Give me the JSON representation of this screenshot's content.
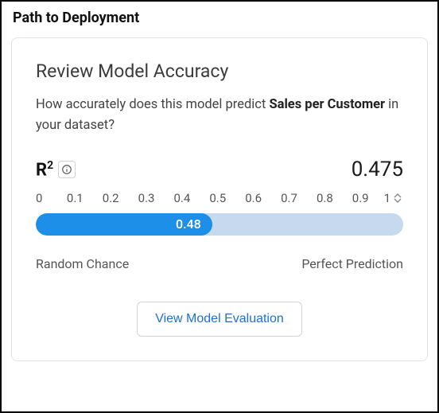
{
  "page": {
    "title": "Path to Deployment"
  },
  "card": {
    "title": "Review Model Accuracy",
    "subtitle_prefix": "How accurately does this model predict ",
    "subtitle_bold": "Sales per Customer",
    "subtitle_suffix": " in your dataset?"
  },
  "metric": {
    "label_html": "R²",
    "label_base": "R",
    "label_sup": "2",
    "info_icon": "info-icon",
    "value": "0.475"
  },
  "chart_data": {
    "type": "bar",
    "orientation": "horizontal",
    "title": "R²",
    "xlabel": "",
    "ylabel": "",
    "xlim": [
      0,
      1
    ],
    "ticks": [
      "0",
      "0.1",
      "0.2",
      "0.3",
      "0.4",
      "0.5",
      "0.6",
      "0.7",
      "0.8",
      "0.9",
      "1"
    ],
    "categories": [
      "R²"
    ],
    "values": [
      0.475
    ],
    "display_value": "0.48",
    "fill_percent": "48%",
    "legend_left": "Random Chance",
    "legend_right": "Perfect Prediction",
    "colors": {
      "fill": "#1e8fe8",
      "track": "#c6d9ee"
    }
  },
  "actions": {
    "view_evaluation": "View Model Evaluation"
  }
}
